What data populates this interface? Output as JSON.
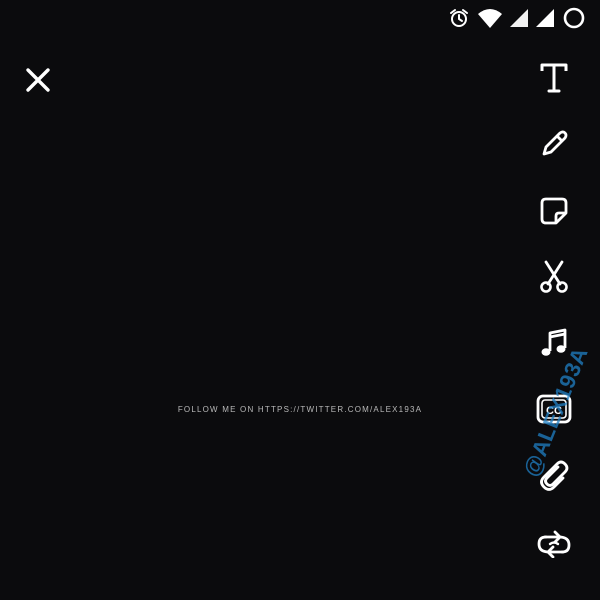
{
  "status_bar": {
    "icons": [
      "alarm-icon",
      "wifi-icon",
      "signal-icon-1",
      "signal-icon-2",
      "battery-ring-icon"
    ]
  },
  "close_button": {
    "icon": "close-icon"
  },
  "tools": [
    {
      "name": "text",
      "icon": "text-tool-icon"
    },
    {
      "name": "pencil",
      "icon": "pencil-icon"
    },
    {
      "name": "sticker",
      "icon": "sticker-icon"
    },
    {
      "name": "scissors",
      "icon": "scissors-icon"
    },
    {
      "name": "music",
      "icon": "music-note-icon"
    },
    {
      "name": "captions",
      "icon": "cc-icon",
      "label": "CC"
    },
    {
      "name": "attachment",
      "icon": "paperclip-icon"
    },
    {
      "name": "loop",
      "icon": "loop-icon"
    }
  ],
  "text_tool_glyph": "T",
  "caption": "FOLLOW ME ON HTTPS://TWITTER.COM/ALEX193A",
  "watermark": "@ALEX193A",
  "colors": {
    "background": "#0b0b0d",
    "icon": "#ffffff",
    "watermark": "#1f7fc4",
    "caption": "#b9b9b9"
  }
}
